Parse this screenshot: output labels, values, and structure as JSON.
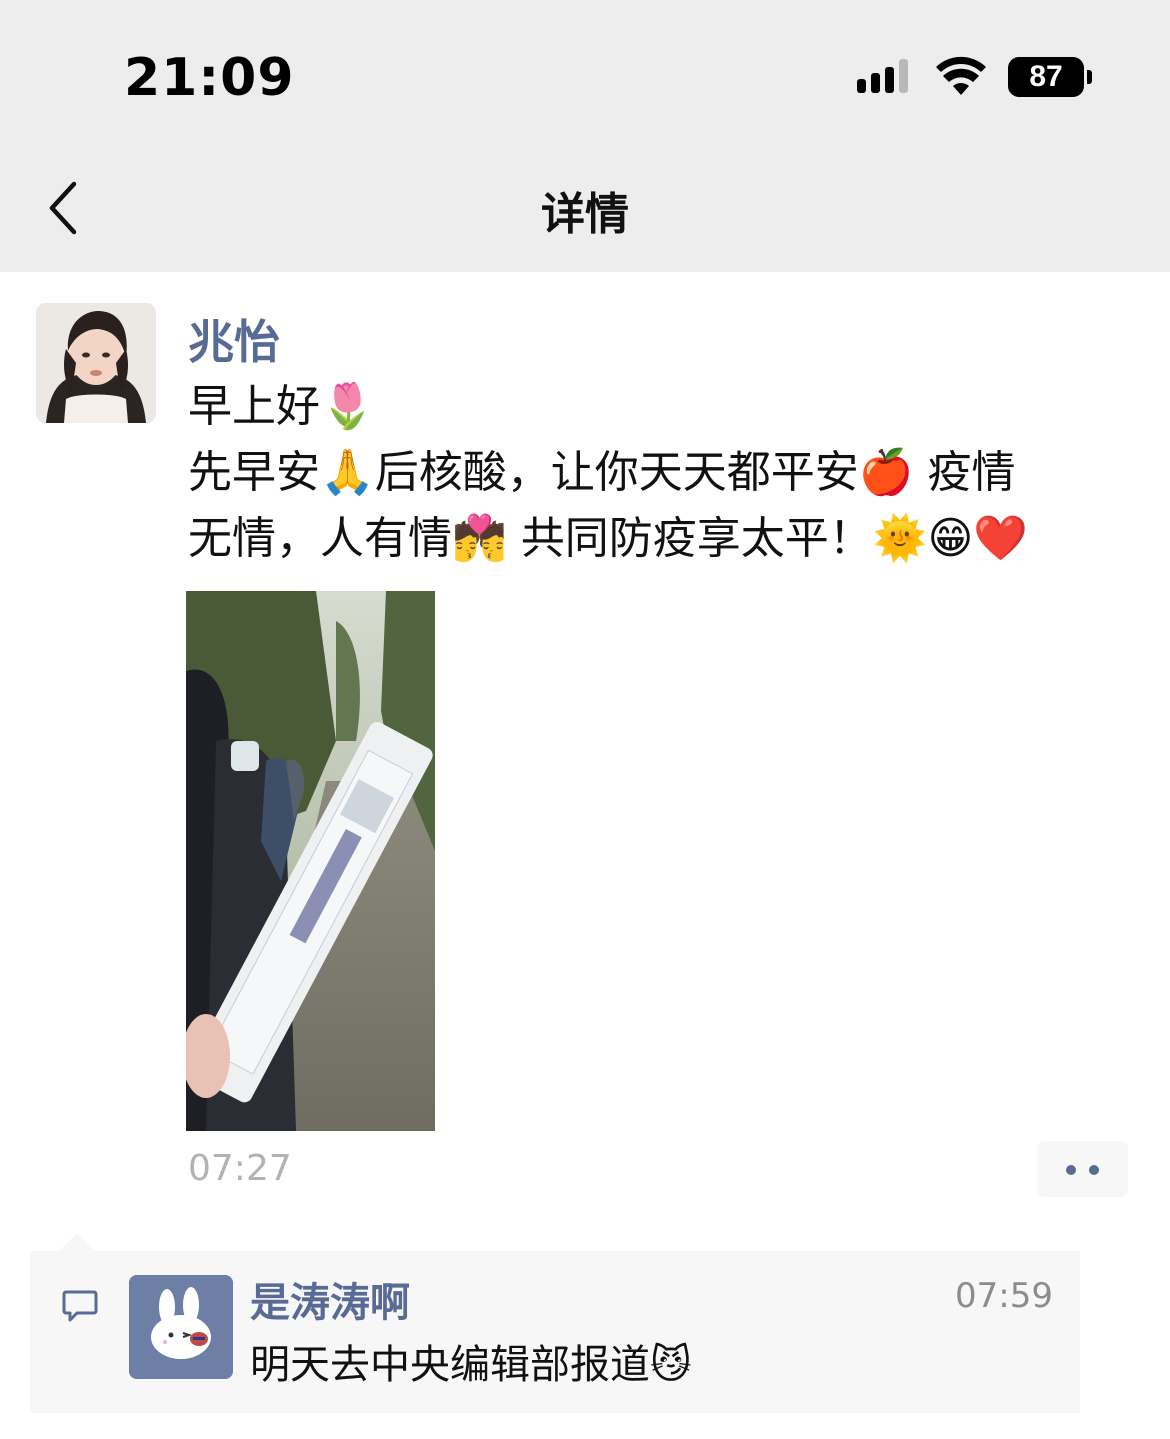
{
  "status_bar": {
    "time": "21:09",
    "battery": "87"
  },
  "nav": {
    "title": "详情",
    "back_icon": "chevron-left-icon"
  },
  "post": {
    "author": "兆怡",
    "lines": [
      "早上好🌷",
      "先早安🙏后核酸，让你天天都平安🍎 疫情",
      "无情，人有情💏 共同防疫享太平！🌞😁❤️"
    ],
    "time": "07:27",
    "more_icon": "more-dots-icon"
  },
  "comments": [
    {
      "name": "是涛涛啊",
      "time": "07:59",
      "text": "明天去中央编辑部报道😼"
    }
  ],
  "colors": {
    "nav_bg": "#ededed",
    "link_blue": "#576b95",
    "comment_bg": "#f7f7f7",
    "time_gray": "#b2b2b2"
  }
}
